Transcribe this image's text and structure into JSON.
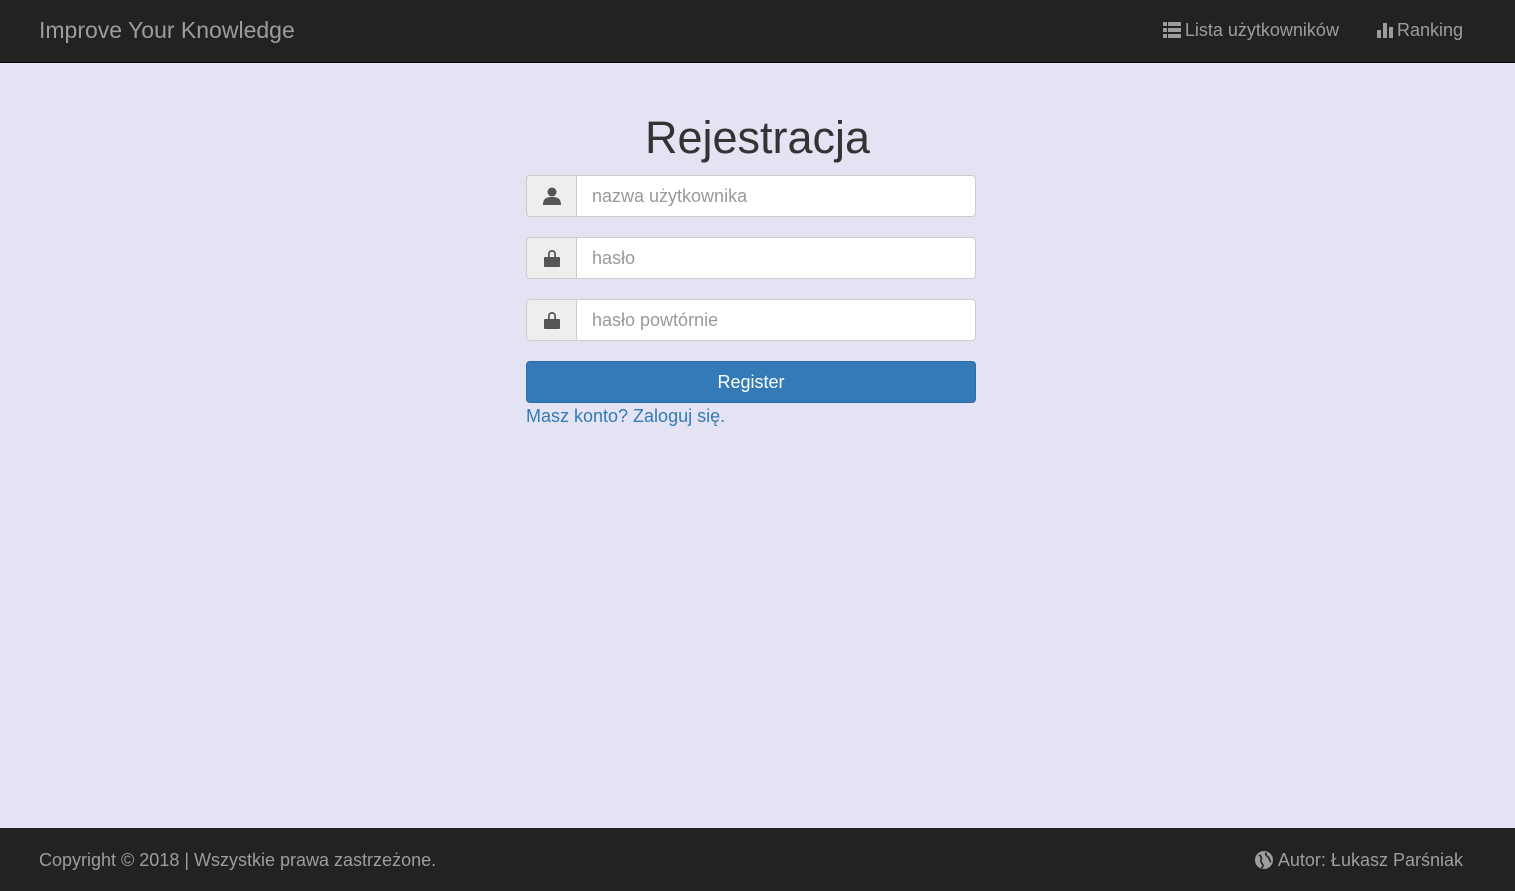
{
  "navbar": {
    "brand": "Improve Your Knowledge",
    "links": [
      {
        "label": "Lista użytkowników",
        "icon": "list-icon"
      },
      {
        "label": "Ranking",
        "icon": "bar-chart-icon"
      }
    ]
  },
  "form": {
    "title": "Rejestracja",
    "username_placeholder": "nazwa użytkownika",
    "password_placeholder": "hasło",
    "password_repeat_placeholder": "hasło powtórnie",
    "submit_label": "Register",
    "login_link": "Masz konto? Zaloguj się."
  },
  "footer": {
    "copyright": "Copyright © 2018 | Wszystkie prawa zastrzeżone.",
    "author": "Autor: Łukasz Parśniak"
  },
  "colors": {
    "navbar_bg": "#222222",
    "page_bg": "#e3e3f3",
    "primary": "#337ab7",
    "nav_text": "#9d9d9d"
  }
}
